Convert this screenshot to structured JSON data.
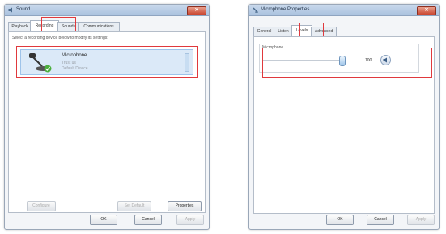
{
  "left_window": {
    "title": "Sound",
    "tabs": [
      "Playback",
      "Recording",
      "Sounds",
      "Communications"
    ],
    "active_tab": "Recording",
    "instruction": "Select a recording device below to modify its settings:",
    "device": {
      "name": "Microphone",
      "line2": "Trust us",
      "status": "Default Device"
    },
    "configure_label": "Configure",
    "set_default_label": "Set Default",
    "properties_label": "Properties",
    "ok_label": "OK",
    "cancel_label": "Cancel",
    "apply_label": "Apply"
  },
  "right_window": {
    "title": "Microphone Properties",
    "tabs": [
      "General",
      "Listen",
      "Levels",
      "Advanced"
    ],
    "active_tab": "Levels",
    "group_label": "Microphone",
    "level_value": "100",
    "slider_level_percent": 100,
    "ok_label": "OK",
    "cancel_label": "Cancel",
    "apply_label": "Apply"
  },
  "colors": {
    "highlight": "#e0393d",
    "titlebar": "#a9c1de",
    "selection": "#dbe9f8"
  },
  "icons": [
    "sound-speaker-icon",
    "close-icon",
    "microphone-icon",
    "default-check-icon",
    "speaker-mute-icon"
  ]
}
